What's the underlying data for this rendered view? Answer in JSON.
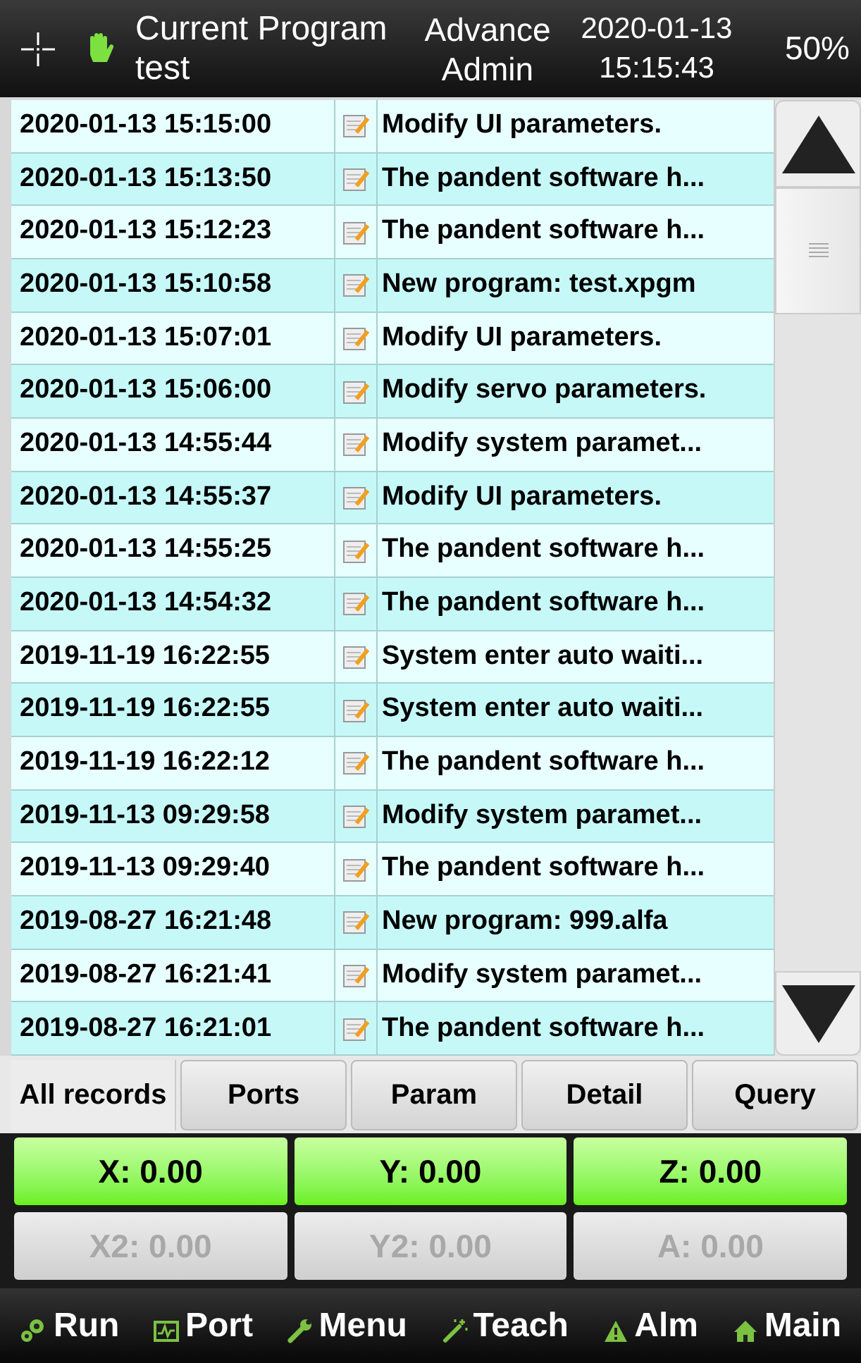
{
  "header": {
    "program_label": "Current Program",
    "program_name": "test",
    "mode": "Advance",
    "user": "Admin",
    "date": "2020-01-13",
    "time": "15:15:43",
    "speed": "50%"
  },
  "records": [
    {
      "time": "2020-01-13 15:15:00",
      "message": "Modify UI parameters."
    },
    {
      "time": "2020-01-13 15:13:50",
      "message": "The pandent software h..."
    },
    {
      "time": "2020-01-13 15:12:23",
      "message": "The pandent software h..."
    },
    {
      "time": "2020-01-13 15:10:58",
      "message": "New program: test.xpgm"
    },
    {
      "time": "2020-01-13 15:07:01",
      "message": "Modify UI parameters."
    },
    {
      "time": "2020-01-13 15:06:00",
      "message": "Modify servo parameters."
    },
    {
      "time": "2020-01-13 14:55:44",
      "message": "Modify system paramet..."
    },
    {
      "time": "2020-01-13 14:55:37",
      "message": "Modify UI parameters."
    },
    {
      "time": "2020-01-13 14:55:25",
      "message": "The pandent software h..."
    },
    {
      "time": "2020-01-13 14:54:32",
      "message": "The pandent software h..."
    },
    {
      "time": "2019-11-19 16:22:55",
      "message": "System enter auto waiti..."
    },
    {
      "time": "2019-11-19 16:22:55",
      "message": "System enter auto waiti..."
    },
    {
      "time": "2019-11-19 16:22:12",
      "message": "The pandent software h..."
    },
    {
      "time": "2019-11-13 09:29:58",
      "message": "Modify system paramet..."
    },
    {
      "time": "2019-11-13 09:29:40",
      "message": "The pandent software h..."
    },
    {
      "time": "2019-08-27 16:21:48",
      "message": "New program: 999.alfa"
    },
    {
      "time": "2019-08-27 16:21:41",
      "message": "Modify system paramet..."
    },
    {
      "time": "2019-08-27 16:21:01",
      "message": "The pandent software h..."
    }
  ],
  "tabs": [
    {
      "label": "All records",
      "selected": true
    },
    {
      "label": "Ports",
      "selected": false
    },
    {
      "label": "Param",
      "selected": false
    },
    {
      "label": "Detail",
      "selected": false
    },
    {
      "label": "Query",
      "selected": false
    }
  ],
  "axes": [
    {
      "label": "X: 0.00",
      "disabled": false
    },
    {
      "label": "Y: 0.00",
      "disabled": false
    },
    {
      "label": "Z: 0.00",
      "disabled": false
    },
    {
      "label": "X2: 0.00",
      "disabled": true
    },
    {
      "label": "Y2: 0.00",
      "disabled": true
    },
    {
      "label": "A: 0.00",
      "disabled": true
    }
  ],
  "nav": [
    {
      "kind": "run",
      "label": "Run"
    },
    {
      "kind": "port",
      "label": "Port"
    },
    {
      "kind": "menu",
      "label": "Menu"
    },
    {
      "kind": "teach",
      "label": "Teach"
    },
    {
      "kind": "alarm",
      "label": "Alm"
    },
    {
      "kind": "main",
      "label": "Main"
    }
  ]
}
